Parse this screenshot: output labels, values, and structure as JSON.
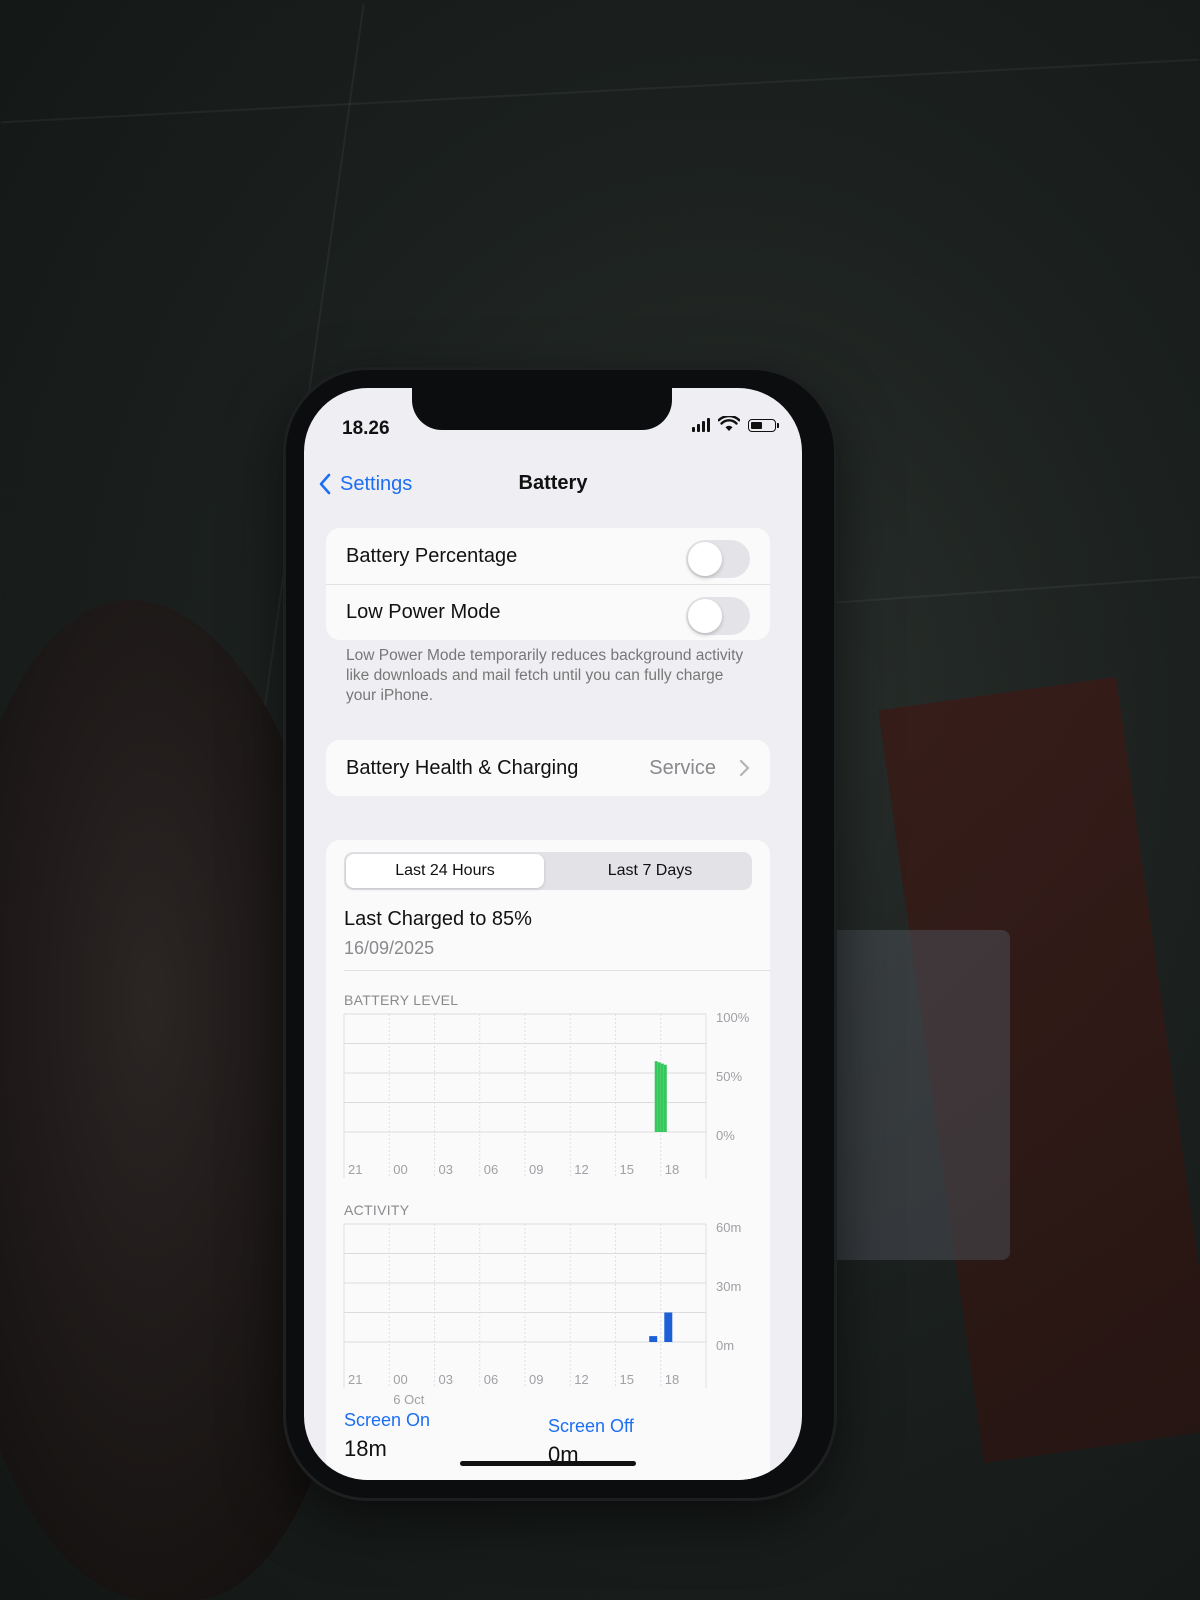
{
  "status_bar": {
    "time": "18.26",
    "battery_level": 0.5
  },
  "nav": {
    "back_label": "Settings",
    "title": "Battery"
  },
  "toggles": [
    {
      "label": "Battery Percentage",
      "on": false
    },
    {
      "label": "Low Power Mode",
      "on": false
    }
  ],
  "footnote": "Low Power Mode temporarily reduces background activity like downloads and mail fetch until you can fully charge your iPhone.",
  "health": {
    "label": "Battery Health & Charging",
    "value": "Service"
  },
  "usage": {
    "tabs": [
      "Last 24 Hours",
      "Last 7 Days"
    ],
    "active_tab": 0,
    "last_charged": "Last Charged to 85%",
    "last_charged_date": "16/09/2025"
  },
  "chart_data": [
    {
      "type": "bar",
      "title": "BATTERY LEVEL",
      "categories": [
        "21",
        "00",
        "03",
        "06",
        "09",
        "12",
        "15",
        "18"
      ],
      "y_ticks": [
        "100%",
        "50%",
        "0%"
      ],
      "ylim": [
        0,
        100
      ],
      "series": [
        {
          "color": "#34c759",
          "points": [
            {
              "hour": 17.7,
              "value": 60
            },
            {
              "hour": 17.9,
              "value": 59
            },
            {
              "hour": 18.1,
              "value": 58
            },
            {
              "hour": 18.3,
              "value": 57
            }
          ]
        }
      ]
    },
    {
      "type": "bar",
      "title": "ACTIVITY",
      "categories": [
        "21",
        "00",
        "03",
        "06",
        "09",
        "12",
        "15",
        "18"
      ],
      "category_sublabel": {
        "index": 1,
        "text": "6 Oct"
      },
      "y_ticks": [
        "60m",
        "30m",
        "0m"
      ],
      "ylim": [
        0,
        60
      ],
      "series": [
        {
          "color": "#1c5fd6",
          "points": [
            {
              "hour": 17.5,
              "value": 3
            },
            {
              "hour": 18.5,
              "value": 15
            }
          ]
        }
      ]
    }
  ],
  "screen_time": {
    "on_label": "Screen On",
    "on_value": "18m",
    "off_label": "Screen Off",
    "off_value": "0m"
  }
}
